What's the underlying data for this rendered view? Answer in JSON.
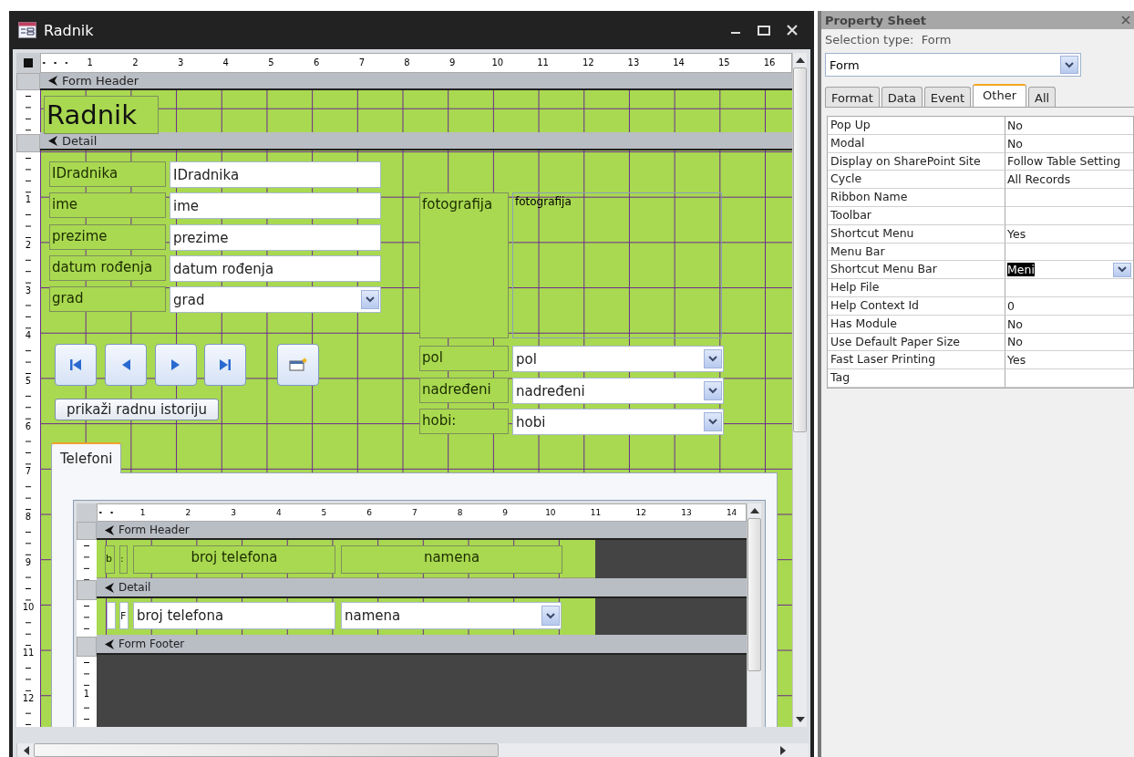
{
  "window": {
    "title": "Radnik"
  },
  "ruler": {
    "ticks": [
      "1",
      "2",
      "3",
      "4",
      "5",
      "6",
      "7",
      "8",
      "9",
      "10",
      "11",
      "12",
      "13",
      "14",
      "15",
      "16"
    ]
  },
  "vertical_ruler": {
    "ticks": [
      "1",
      "2",
      "3",
      "4",
      "5",
      "6",
      "7",
      "8",
      "9",
      "10",
      "11",
      "12"
    ]
  },
  "form_header": {
    "label": "Form Header",
    "title": "Radnik"
  },
  "detail": {
    "label": "Detail",
    "left_fields": [
      {
        "label": "IDradnika",
        "value": "IDradnika",
        "kind": "text"
      },
      {
        "label": "ime",
        "value": "ime",
        "kind": "text"
      },
      {
        "label": "prezime",
        "value": "prezime",
        "kind": "text"
      },
      {
        "label": "datum rođenja",
        "value": "datum rođenja",
        "kind": "text"
      },
      {
        "label": "grad",
        "value": "grad",
        "kind": "combo"
      }
    ],
    "photo": {
      "label": "fotografija",
      "frame": "fotografija"
    },
    "right_fields": [
      {
        "label": "pol",
        "value": "pol",
        "kind": "combo"
      },
      {
        "label": "nadređeni",
        "value": "nadređeni",
        "kind": "combo"
      },
      {
        "label": "hobi:",
        "value": "hobi",
        "kind": "combo"
      }
    ],
    "nav_buttons": [
      {
        "kind": "first"
      },
      {
        "kind": "previous"
      },
      {
        "kind": "next"
      },
      {
        "kind": "last"
      },
      {
        "kind": "action"
      }
    ],
    "history_button": "prikaži radnu istoriju",
    "tabs": [
      {
        "label": "Telefoni",
        "selected": true
      }
    ]
  },
  "subform": {
    "ruler_ticks": [
      "1",
      "2",
      "3",
      "4",
      "5",
      "6",
      "7",
      "8",
      "9",
      "10",
      "11",
      "12",
      "13",
      "14"
    ],
    "vertical_ticks": [
      "1"
    ],
    "header_label": "Form Header",
    "header_controls": [
      {
        "text": "b"
      },
      {
        "text": ":"
      },
      {
        "text": "broj telefona"
      },
      {
        "text": "namena"
      }
    ],
    "detail_label": "Detail",
    "detail_controls": [
      {
        "kind": "stub"
      },
      {
        "kind": "stub",
        "text": "F"
      },
      {
        "kind": "text",
        "text": "broj telefona"
      },
      {
        "kind": "combo",
        "text": "namena"
      }
    ],
    "footer_label": "Form Footer"
  },
  "property_sheet": {
    "title": "Property Sheet",
    "selection_label": "Selection type:",
    "selection_type": "Form",
    "object": "Form",
    "tabs": [
      {
        "label": "Format",
        "selected": false
      },
      {
        "label": "Data",
        "selected": false
      },
      {
        "label": "Event",
        "selected": false
      },
      {
        "label": "Other",
        "selected": true
      },
      {
        "label": "All",
        "selected": false
      }
    ],
    "properties": [
      {
        "name": "Pop Up",
        "value": "No",
        "selected": false
      },
      {
        "name": "Modal",
        "value": "No",
        "selected": false
      },
      {
        "name": "Display on SharePoint Site",
        "value": "Follow Table Setting",
        "selected": false
      },
      {
        "name": "Cycle",
        "value": "All Records",
        "selected": false
      },
      {
        "name": "Ribbon Name",
        "selected": false
      },
      {
        "name": "Toolbar",
        "selected": false
      },
      {
        "name": "Shortcut Menu",
        "value": "Yes",
        "selected": false
      },
      {
        "name": "Menu Bar",
        "selected": false
      },
      {
        "name": "Shortcut Menu Bar",
        "value": "Meni",
        "selected": true
      },
      {
        "name": "Help File",
        "selected": false
      },
      {
        "name": "Help Context Id",
        "value": "0",
        "selected": false
      },
      {
        "name": "Has Module",
        "value": "No",
        "selected": false
      },
      {
        "name": "Use Default Paper Size",
        "value": "No",
        "selected": false
      },
      {
        "name": "Fast Laser Printing",
        "value": "Yes",
        "selected": false
      },
      {
        "name": "Tag",
        "selected": false
      }
    ]
  }
}
